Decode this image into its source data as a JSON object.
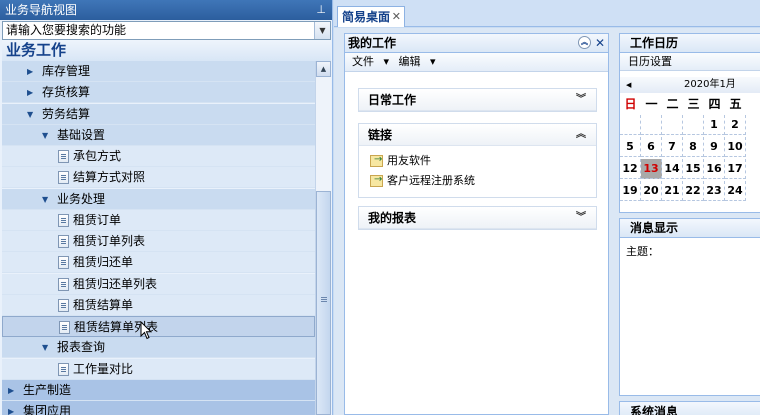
{
  "nav": {
    "title": "业务导航视图",
    "pin_icon": "pin-icon",
    "search_placeholder": "请输入您要搜索的功能",
    "section_title": "业务工作",
    "tree": [
      {
        "label": "库存管理",
        "level": 1,
        "type": "collapsed"
      },
      {
        "label": "存货核算",
        "level": 1,
        "type": "collapsed"
      },
      {
        "label": "劳务结算",
        "level": 1,
        "type": "expanded"
      },
      {
        "label": "基础设置",
        "level": 2,
        "type": "expanded"
      },
      {
        "label": "承包方式",
        "level": 3,
        "type": "leaf"
      },
      {
        "label": "结算方式对照",
        "level": 3,
        "type": "leaf"
      },
      {
        "label": "业务处理",
        "level": 2,
        "type": "expanded"
      },
      {
        "label": "租赁订单",
        "level": 3,
        "type": "leaf"
      },
      {
        "label": "租赁订单列表",
        "level": 3,
        "type": "leaf"
      },
      {
        "label": "租赁归还单",
        "level": 3,
        "type": "leaf"
      },
      {
        "label": "租赁归还单列表",
        "level": 3,
        "type": "leaf"
      },
      {
        "label": "租赁结算单",
        "level": 3,
        "type": "leaf"
      },
      {
        "label": "租赁结算单列表",
        "level": 3,
        "type": "leaf",
        "selected": true
      },
      {
        "label": "报表查询",
        "level": 2,
        "type": "expanded"
      },
      {
        "label": "工作量对比",
        "level": 3,
        "type": "leaf"
      },
      {
        "label": "生产制造",
        "level": 0,
        "type": "collapsed"
      },
      {
        "label": "集团应用",
        "level": 0,
        "type": "collapsed"
      }
    ]
  },
  "tabs": [
    {
      "label": "简易桌面",
      "active": true
    }
  ],
  "mywork": {
    "title": "我的工作",
    "toolbar": {
      "file": "文件",
      "edit": "编辑"
    },
    "portlets": {
      "daily": "日常工作",
      "links": "链接",
      "reports": "我的报表"
    },
    "links": [
      "用友软件",
      "客户远程注册系统"
    ]
  },
  "calendar": {
    "title": "工作日历",
    "settings": "日历设置",
    "month": "2020年1月",
    "weekdays": [
      "日",
      "一",
      "二",
      "三",
      "四",
      "五"
    ],
    "rows": [
      [
        "",
        "",
        "",
        "",
        "1",
        "2"
      ],
      [
        "5",
        "6",
        "7",
        "8",
        "9",
        "10"
      ],
      [
        "12",
        "13",
        "14",
        "15",
        "16",
        "17"
      ],
      [
        "19",
        "20",
        "21",
        "22",
        "23",
        "24"
      ]
    ],
    "today": "13",
    "colors": {
      "sunday": "#d00000",
      "today_bg": "#a9a9a9"
    }
  },
  "messages": {
    "title": "消息显示",
    "subject_label": "主题："
  },
  "system_messages": {
    "title": "系统消息"
  },
  "colors": {
    "nav_title_bg": "#2c5e9e",
    "accent": "#15428b",
    "border": "#99bbe8"
  }
}
